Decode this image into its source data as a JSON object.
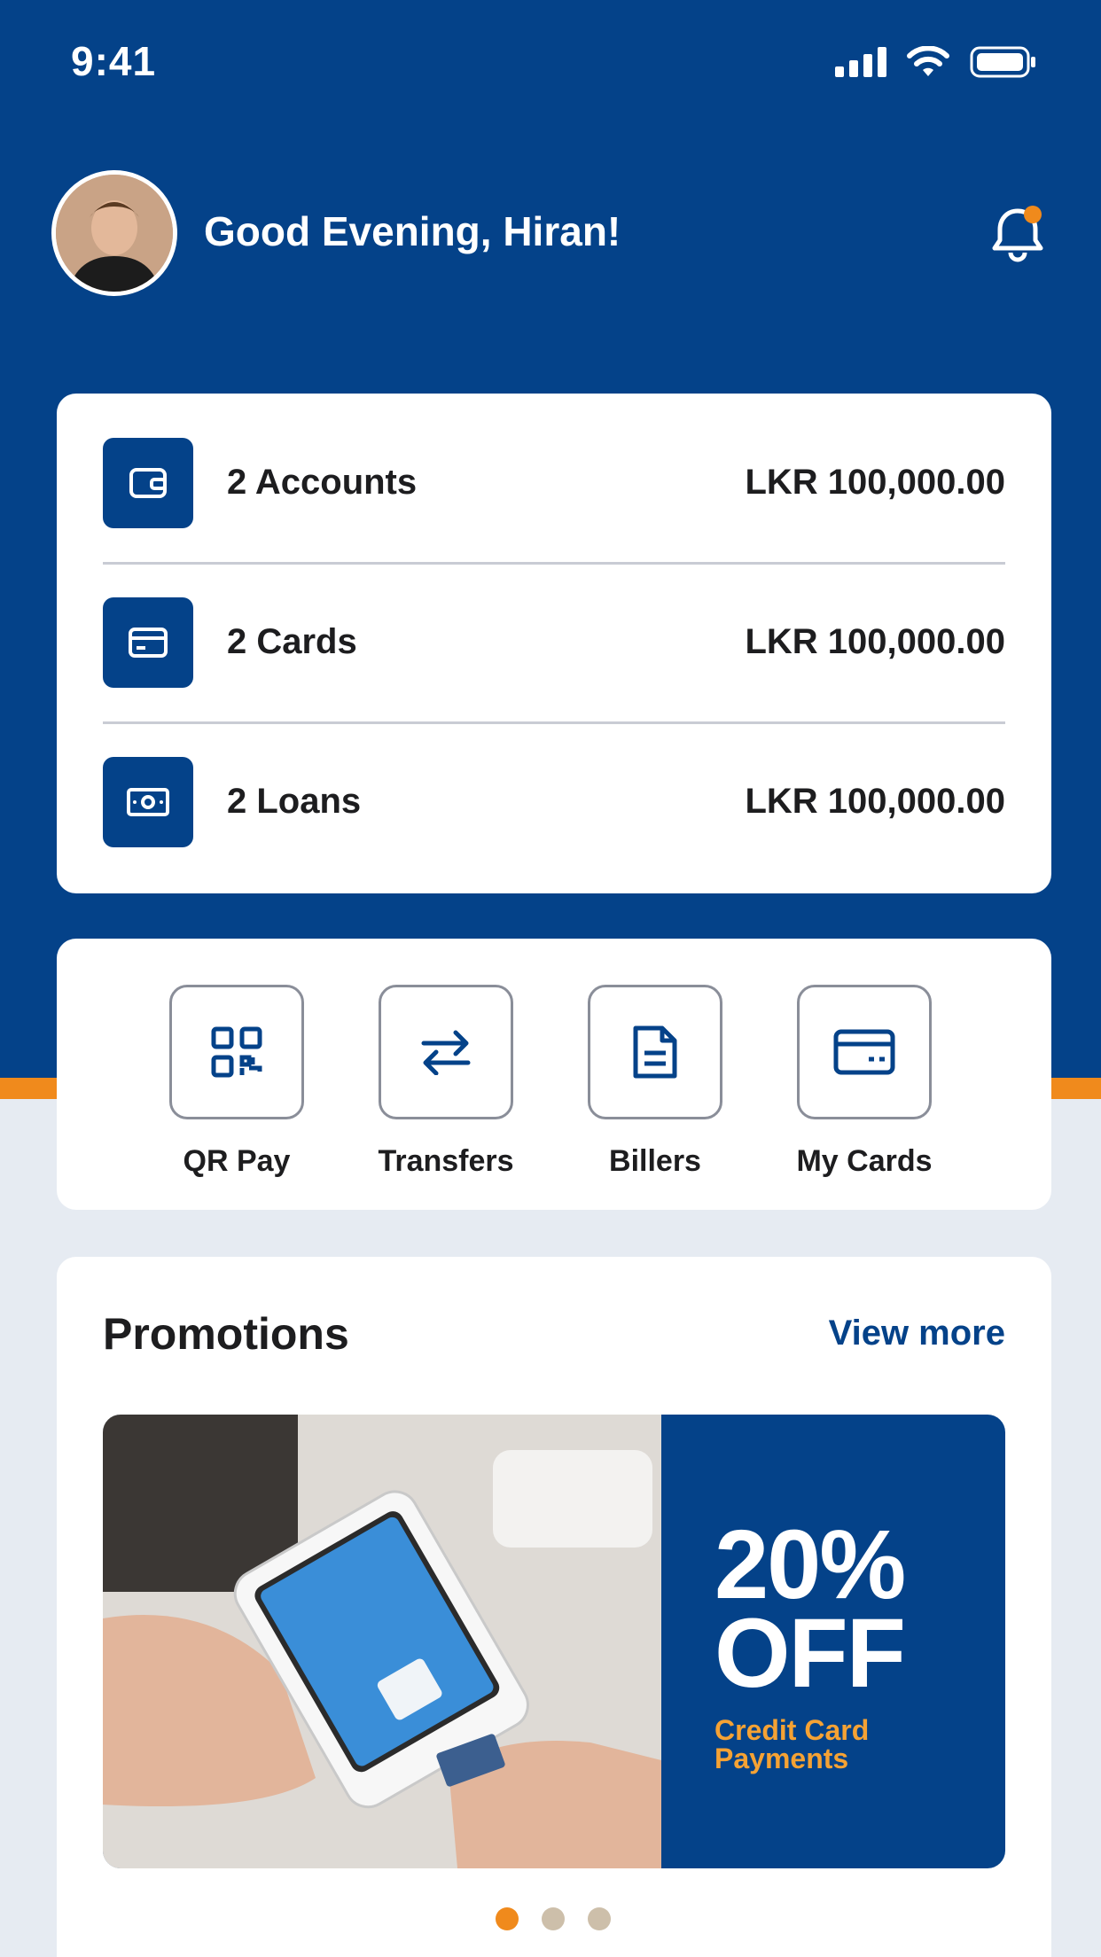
{
  "status_bar": {
    "time": "9:41"
  },
  "header": {
    "greeting": "Good Evening, Hiran!"
  },
  "summary": [
    {
      "icon": "wallet-icon",
      "label": "2 Accounts",
      "amount": "LKR 100,000.00"
    },
    {
      "icon": "card-icon",
      "label": "2 Cards",
      "amount": "LKR 100,000.00"
    },
    {
      "icon": "cash-icon",
      "label": "2 Loans",
      "amount": "LKR 100,000.00"
    }
  ],
  "quick_actions": [
    {
      "icon": "qr-code-icon",
      "label": "QR Pay"
    },
    {
      "icon": "transfer-arrows-icon",
      "label": "Transfers"
    },
    {
      "icon": "document-icon",
      "label": "Billers"
    },
    {
      "icon": "credit-card-icon",
      "label": "My Cards"
    }
  ],
  "promotions": {
    "title": "Promotions",
    "view_more": "View more",
    "banner": {
      "headline_1": "20%",
      "headline_2": "OFF",
      "subtitle_1": "Credit Card",
      "subtitle_2": "Payments"
    },
    "carousel": {
      "count": 3,
      "active_index": 0
    }
  },
  "colors": {
    "primary": "#044289",
    "accent": "#f08a1c",
    "background": "#e6ebf2",
    "text": "#1d1d1f"
  }
}
